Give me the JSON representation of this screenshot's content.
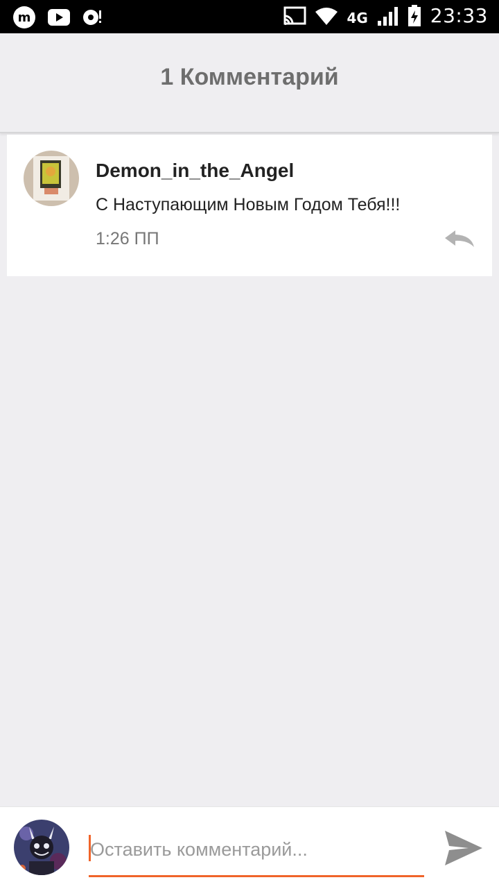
{
  "status_bar": {
    "time": "23:33",
    "network": "4G",
    "left_icons": [
      "app-m-icon",
      "youtube-icon",
      "sync-icon"
    ],
    "right_icons": [
      "cast-icon",
      "wifi-icon",
      "signal-icon",
      "battery-charging-icon"
    ]
  },
  "header": {
    "title": "1 Комментарий"
  },
  "comments": [
    {
      "username": "Demon_in_the_Angel",
      "text": "С Наступающим Новым Годом Тебя!!!",
      "time": "1:26 ПП",
      "avatar_icon": "user-avatar-icon",
      "reply_icon": "reply-icon"
    }
  ],
  "composer": {
    "placeholder": "Оставить комментарий...",
    "value": "",
    "send_icon": "send-icon",
    "avatar_icon": "current-user-avatar-icon"
  },
  "colors": {
    "accent": "#f0642a",
    "background": "#efeef1",
    "header_text": "#6e6e6e",
    "icon_gray": "#8e8e8e"
  }
}
